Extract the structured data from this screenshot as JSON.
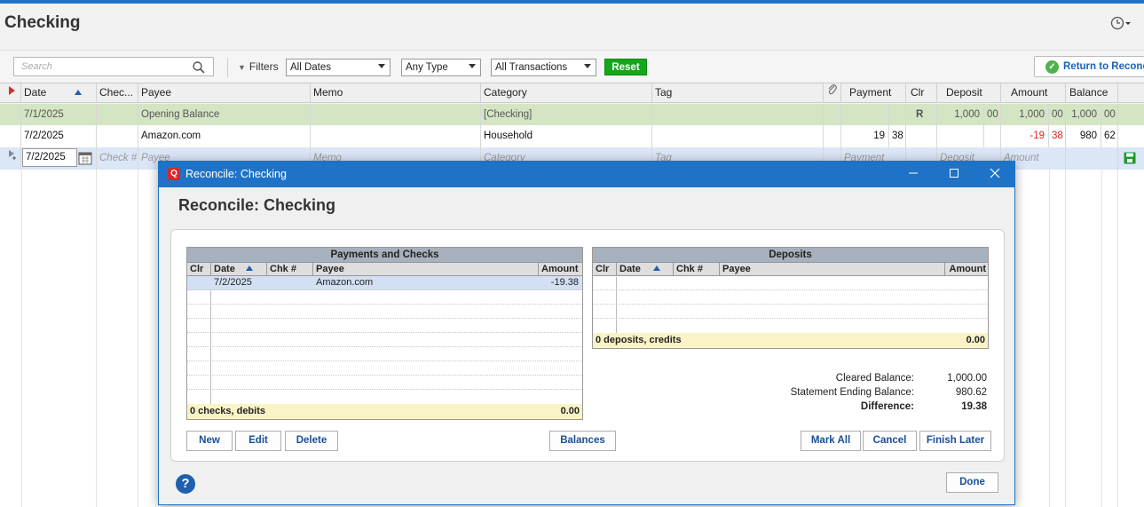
{
  "page": {
    "title": "Checking"
  },
  "filterbar": {
    "search_placeholder": "Search",
    "filters_label": "Filters",
    "dates": "All Dates",
    "type": "Any Type",
    "transactions": "All Transactions",
    "reset_label": "Reset",
    "return_label": "Return to Reconcile"
  },
  "register": {
    "columns": [
      "Date",
      "Chec...",
      "Payee",
      "Memo",
      "Category",
      "Tag",
      "Payment",
      "Clr",
      "Deposit",
      "Amount",
      "Balance"
    ],
    "rows": [
      {
        "date": "7/1/2025",
        "check": "",
        "payee": "Opening Balance",
        "memo": "",
        "category": "[Checking]",
        "tag": "",
        "payment_int": "",
        "payment_dec": "",
        "clr": "R",
        "deposit_int": "1,000",
        "deposit_dec": "00",
        "amount_int": "1,000",
        "amount_dec": "00",
        "balance_int": "1,000",
        "balance_dec": "00"
      },
      {
        "date": "7/2/2025",
        "check": "",
        "payee": "Amazon.com",
        "memo": "",
        "category": "Household",
        "tag": "",
        "payment_int": "19",
        "payment_dec": "38",
        "clr": "",
        "deposit_int": "",
        "deposit_dec": "",
        "amount_int": "-19",
        "amount_dec": "38",
        "balance_int": "980",
        "balance_dec": "62"
      }
    ],
    "new_row": {
      "date": "7/2/2025",
      "check": "Check #",
      "payee": "Payee",
      "memo": "Memo",
      "category": "Category",
      "tag": "Tag",
      "payment": "Payment",
      "deposit": "Deposit",
      "amount": "Amount"
    }
  },
  "dialog": {
    "window_title": "Reconcile: Checking",
    "heading": "Reconcile: Checking",
    "payments": {
      "title": "Payments and Checks",
      "columns": [
        "Clr",
        "Date",
        "Chk #",
        "Payee",
        "Amount"
      ],
      "rows": [
        {
          "clr": "",
          "date": "7/2/2025",
          "chk": "",
          "payee": "Amazon.com",
          "amount": "-19.38"
        }
      ],
      "footer_label": "0 checks, debits",
      "footer_total": "0.00"
    },
    "deposits": {
      "title": "Deposits",
      "columns": [
        "Clr",
        "Date",
        "Chk #",
        "Payee",
        "Amount"
      ],
      "footer_label": "0 deposits, credits",
      "footer_total": "0.00"
    },
    "balances": {
      "cleared_label": "Cleared Balance:",
      "cleared_value": "1,000.00",
      "statement_label": "Statement Ending Balance:",
      "statement_value": "980.62",
      "difference_label": "Difference:",
      "difference_value": "19.38"
    },
    "buttons": {
      "new": "New",
      "edit": "Edit",
      "delete": "Delete",
      "balances": "Balances",
      "mark_all": "Mark All",
      "cancel": "Cancel",
      "finish_later": "Finish Later",
      "done": "Done"
    }
  },
  "colors": {
    "accent": "#1e73c9",
    "reset": "#14a61b",
    "cleared_row": "#d4e5c4",
    "negative": "#e02020"
  }
}
